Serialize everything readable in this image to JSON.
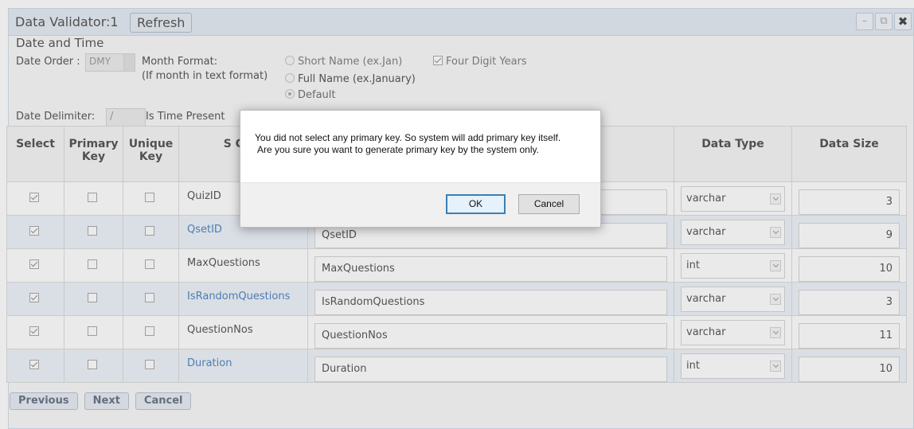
{
  "window": {
    "title": "Data Validator:1",
    "refresh_label": "Refresh",
    "controls": [
      "minimize-icon",
      "restore-icon",
      "close-icon"
    ]
  },
  "date_time": {
    "section_title": "Date and Time",
    "date_order_label": "Date Order :",
    "date_order_value": "DMY",
    "month_format_label": "Month Format:",
    "month_format_hint": "(If month in text format)",
    "options": [
      "Short Name (ex.Jan)",
      "Full Name (ex.January)",
      "Default"
    ],
    "four_digit_years_label": "Four Digit Years",
    "date_delimiter_label": "Date Delimiter:",
    "date_delimiter_value": "/",
    "is_time_present_label": "Is Time Present"
  },
  "grid": {
    "headers": {
      "select": "Select",
      "primary": "Primary Key",
      "unique": "Unique Key",
      "source": "S Colu",
      "data_type": "Data Type",
      "data_size": "Data Size"
    },
    "rows": [
      {
        "name": "QuizID",
        "field": "",
        "type": "varchar",
        "size": "3"
      },
      {
        "name": "QsetID",
        "field": "QsetID",
        "type": "varchar",
        "size": "9"
      },
      {
        "name": "MaxQuestions",
        "field": "MaxQuestions",
        "type": "int",
        "size": "10"
      },
      {
        "name": "IsRandomQuestions",
        "field": "IsRandomQuestions",
        "type": "varchar",
        "size": "3"
      },
      {
        "name": "QuestionNos",
        "field": "QuestionNos",
        "type": "varchar",
        "size": "11"
      },
      {
        "name": "Duration",
        "field": "Duration",
        "type": "int",
        "size": "10"
      }
    ]
  },
  "buttons": {
    "previous": "Previous",
    "next": "Next",
    "cancel": "Cancel"
  },
  "dialog": {
    "line1": "You did not select any primary key. So system will add primary key itself.",
    "line2": "Are you sure you want to generate primary key by the system only.",
    "ok": "OK",
    "cancel": "Cancel"
  },
  "colors": {
    "titlebar": "#dfe7f1",
    "row_alt": "#eaf0f8",
    "link_blue": "#2f6db5",
    "ok_border": "#3c7fb1"
  }
}
